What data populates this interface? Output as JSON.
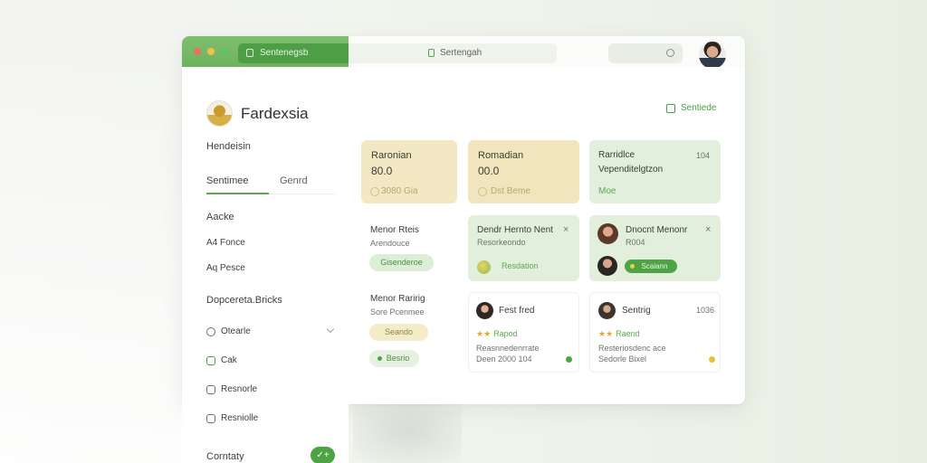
{
  "browser": {
    "tab_label": "Sentenegsb",
    "url_text": "Sertengah"
  },
  "sidebar": {
    "profile_name": "Fardexsia",
    "section_label": "Hendeisin",
    "tabs": [
      "Sentimee",
      "Genrd"
    ],
    "items_group1": [
      "Aacke",
      "A4 Fonce",
      "Aq Pesce"
    ],
    "group2_title": "Dopcereta.Bricks",
    "items_group2": [
      {
        "label": "Otearle",
        "icon": "circle-icon"
      },
      {
        "label": "Cak",
        "icon": "check-square-icon"
      },
      {
        "label": "Resnorle",
        "icon": "square-icon"
      },
      {
        "label": "Resniolle",
        "icon": "square-icon"
      }
    ],
    "footer_label": "Corntaty",
    "footer_button": "✓+"
  },
  "main": {
    "top_action": "Sentiede",
    "stat_cards": [
      {
        "title": "Raronian",
        "value": "80.0",
        "foot": "3080 Gia"
      },
      {
        "title": "Romadian",
        "value": "00.0",
        "foot": "Dst Beme"
      },
      {
        "title": "Rarridlce",
        "subtitle": "Vependitelgtzon",
        "badge": "104",
        "foot": "Moe"
      }
    ],
    "list_left": [
      {
        "title": "Menor Rteis",
        "sub": "Arendouce",
        "pill": "Gisenderoe"
      },
      {
        "title": "Menor Raririg",
        "sub": "Sore Pcenmee",
        "pill": "Seando",
        "pill2": "Besrio"
      }
    ],
    "notif_cards": [
      {
        "title": "Dendr Hernto Nent",
        "sub": "Resorkeondo",
        "pill": "Resdation"
      },
      {
        "title": "Dnocnt Menonr",
        "sub": "R004",
        "pill": "Scaiann"
      }
    ],
    "review_cards": [
      {
        "name": "Fest fred",
        "rating_label": "Rapod",
        "line1": "Reasnnedenrrate",
        "line2": "Deen 2000 104"
      },
      {
        "name": "Sentrig",
        "badge": "1036",
        "rating_label": "Raend",
        "line1": "Resteriosdenc ace",
        "line2": "Sedorle Bixel"
      }
    ]
  },
  "colors": {
    "accent": "#4ea445",
    "yellow_card": "#f2e8c4",
    "green_card": "#e2efdc"
  }
}
